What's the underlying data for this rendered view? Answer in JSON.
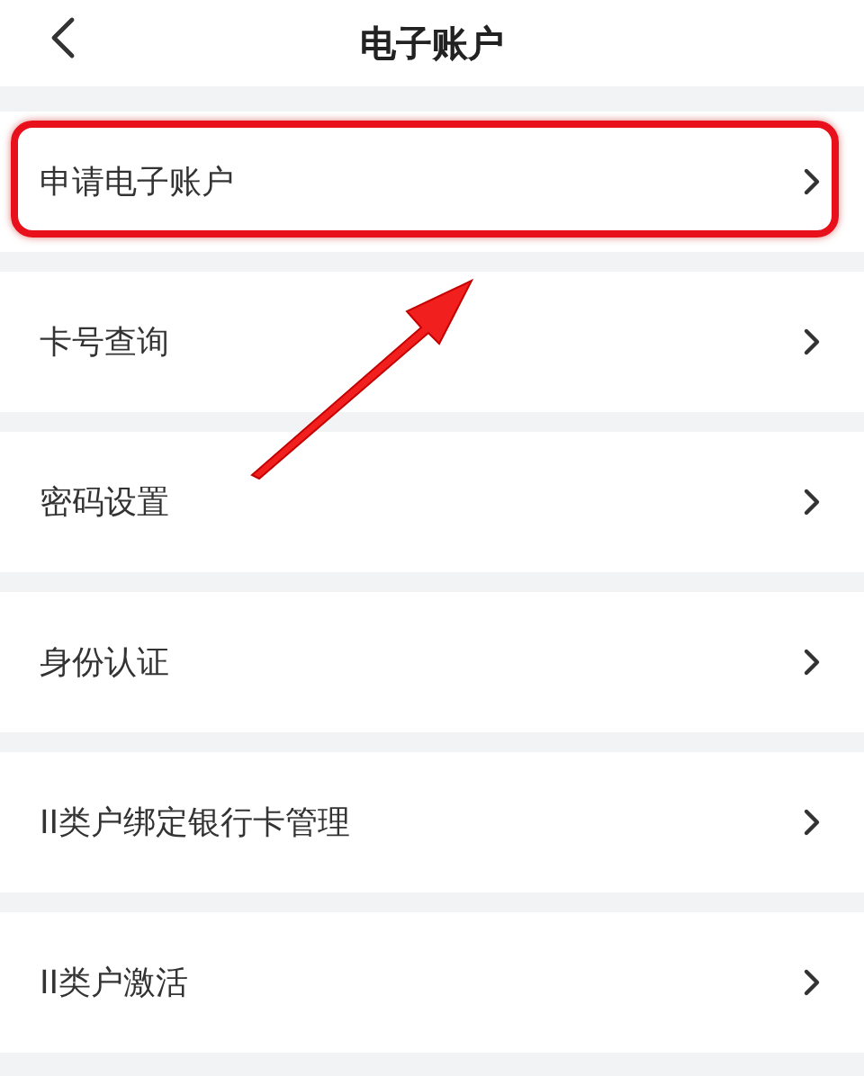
{
  "header": {
    "title": "电子账户"
  },
  "items": [
    {
      "label": "申请电子账户",
      "highlighted": true
    },
    {
      "label": "卡号查询",
      "highlighted": false
    },
    {
      "label": "密码设置",
      "highlighted": false
    },
    {
      "label": "身份认证",
      "highlighted": false
    },
    {
      "label": "II类户绑定银行卡管理",
      "highlighted": false
    },
    {
      "label": "II类户激活",
      "highlighted": false
    }
  ]
}
